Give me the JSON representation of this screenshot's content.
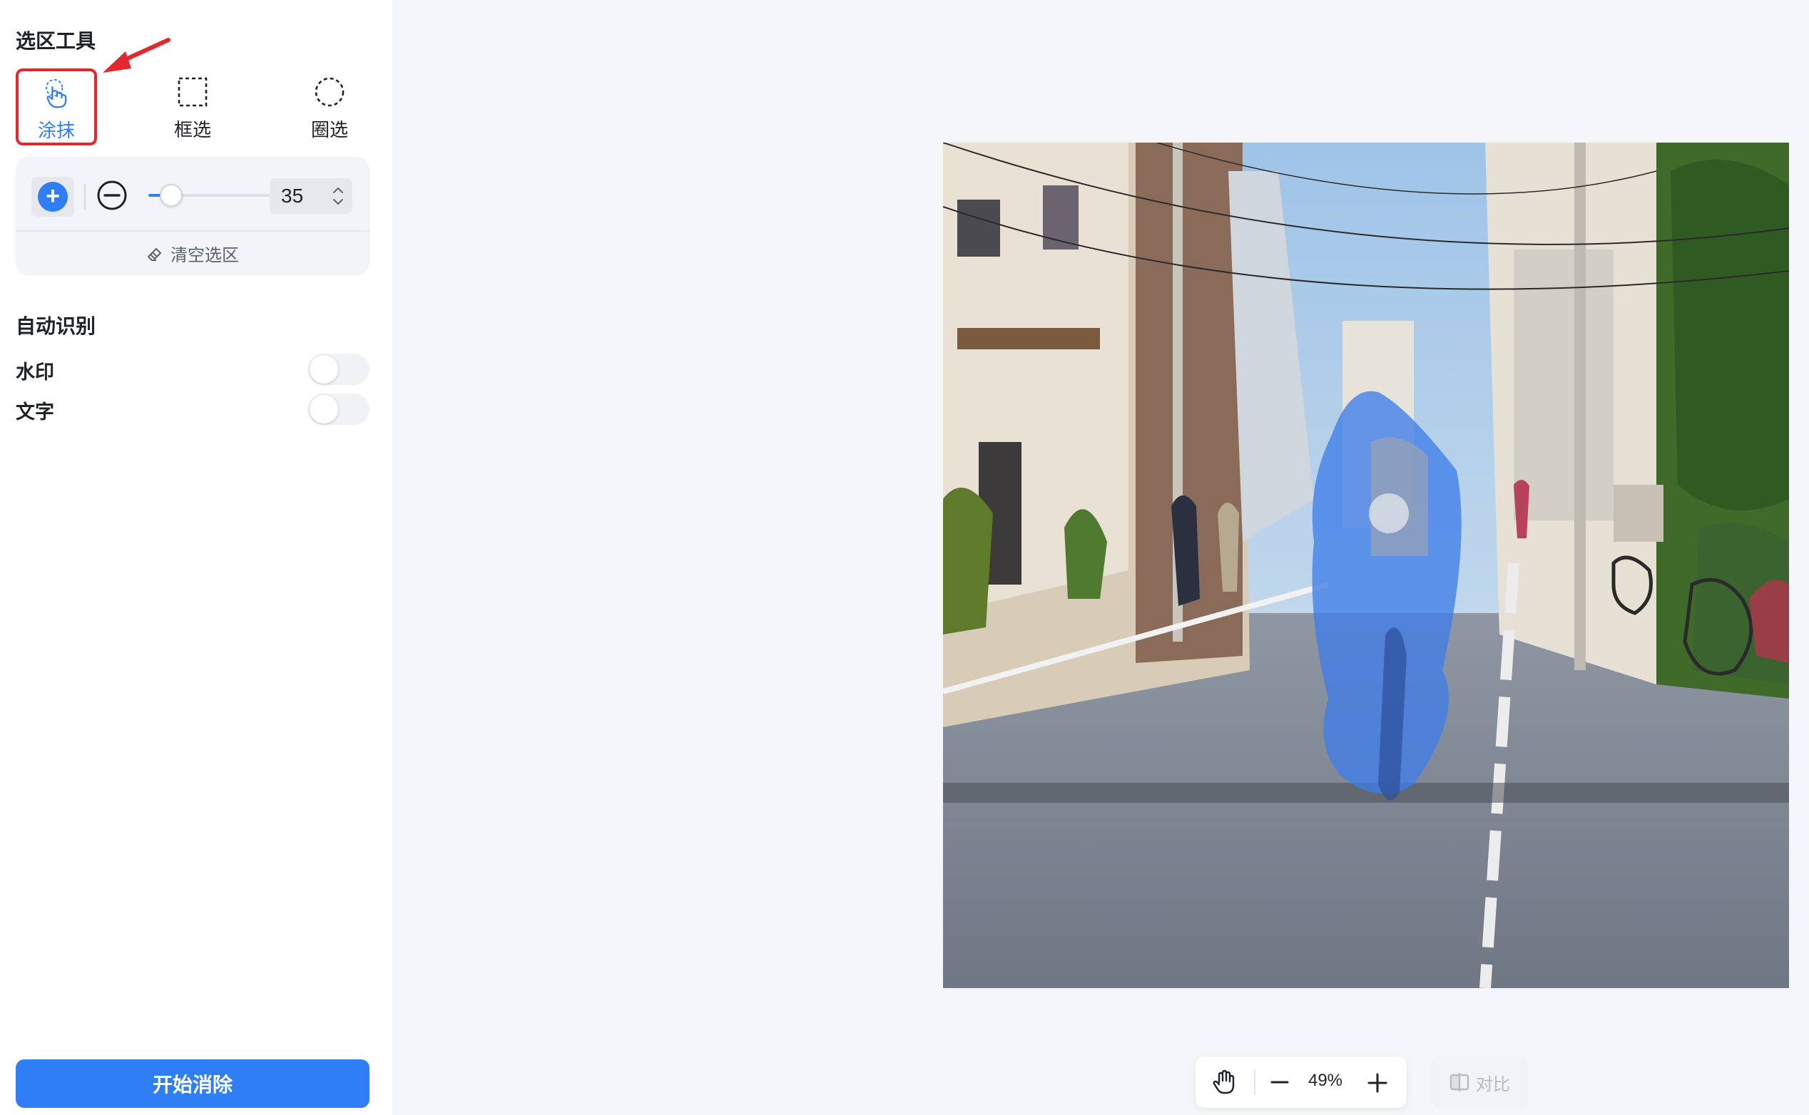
{
  "selection_tools": {
    "title": "选区工具",
    "tools": [
      {
        "label": "涂抹",
        "icon": "finger-tap-icon",
        "active": true
      },
      {
        "label": "框选",
        "icon": "dashed-rectangle-icon",
        "active": false
      },
      {
        "label": "圈选",
        "icon": "dashed-circle-icon",
        "active": false
      }
    ]
  },
  "brush": {
    "size": "35",
    "size_fraction": 0.18,
    "mode": "add",
    "clear_label": "清空选区"
  },
  "auto_detect": {
    "title": "自动识别",
    "items": [
      {
        "label": "水印",
        "enabled": false
      },
      {
        "label": "文字",
        "enabled": false
      }
    ]
  },
  "start_button": "开始消除",
  "zoom": {
    "value": "49%"
  },
  "compare_label": "对比",
  "colors": {
    "accent": "#2f7ef5",
    "highlight": "#e4262d"
  }
}
